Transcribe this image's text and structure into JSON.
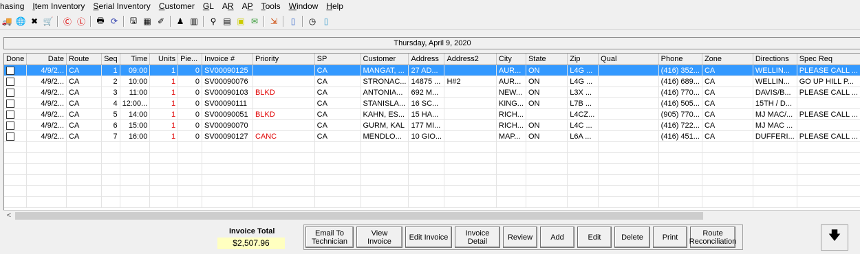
{
  "menu": [
    "hasing",
    "Item Inventory",
    "Serial Inventory",
    "Customer",
    "GL",
    "AR",
    "AP",
    "Tools",
    "Window",
    "Help"
  ],
  "menu_underline": [
    "",
    "I",
    "S",
    "C",
    "G",
    "R",
    "P",
    "T",
    "W",
    "H"
  ],
  "toolbar_icons": [
    "truck-icon",
    "globe-icon",
    "tools-icon",
    "cart-icon",
    "sep",
    "no-c-icon",
    "no-l-icon",
    "sep",
    "printer-icon",
    "refresh-icon",
    "sep",
    "disk-icon",
    "calculator-icon",
    "eraser-icon",
    "sep",
    "user-icon",
    "barcode-icon",
    "sep",
    "pin-icon",
    "notes-icon",
    "note-icon",
    "chat-icon",
    "sep",
    "exit-icon",
    "sep",
    "book-icon",
    "sep",
    "clock-icon",
    "page-icon"
  ],
  "date_header": "Thursday, April 9, 2020",
  "columns": [
    "Done",
    "Date",
    "Route",
    "Seq",
    "Time",
    "Units",
    "Pie...",
    "Invoice #",
    "Priority",
    "SP",
    "Customer",
    "Address",
    "Address2",
    "City",
    "State",
    "Zip",
    "Qual",
    "Phone",
    "Zone",
    "Directions",
    "Spec Req"
  ],
  "rows": [
    {
      "date": "4/9/2...",
      "route": "CA",
      "seq": "1",
      "time": "09:00",
      "units": "1",
      "pie": "0",
      "invoice": "SV00090125",
      "priority": "",
      "sp": "CA",
      "customer": "MANGAT, ...",
      "address": "27 AD...",
      "address2": "",
      "city": "AUR...",
      "state": "ON",
      "zip": "L4G ...",
      "qual": "",
      "phone": "(416) 352...",
      "zone": "CA",
      "directions": "WELLIN...",
      "specreq": "PLEASE CALL ..."
    },
    {
      "date": "4/9/2...",
      "route": "CA",
      "seq": "2",
      "time": "10:00",
      "units": "1",
      "pie": "0",
      "invoice": "SV00090076",
      "priority": "",
      "sp": "CA",
      "customer": "STRONAC...",
      "address": "14875 ...",
      "address2": "H#2",
      "city": "AUR...",
      "state": "ON",
      "zip": "L4G ...",
      "qual": "",
      "phone": "(416) 689...",
      "zone": "CA",
      "directions": "WELLIN...",
      "specreq": "GO UP HILL P..."
    },
    {
      "date": "4/9/2...",
      "route": "CA",
      "seq": "3",
      "time": "11:00",
      "units": "1",
      "pie": "0",
      "invoice": "SV00090103",
      "priority": "BLKD",
      "sp": "CA",
      "customer": "ANTONIA...",
      "address": "692 M...",
      "address2": "",
      "city": "NEW...",
      "state": "ON",
      "zip": "L3X ...",
      "qual": "",
      "phone": "(416) 770...",
      "zone": "CA",
      "directions": "DAVIS/B...",
      "specreq": "PLEASE CALL ..."
    },
    {
      "date": "4/9/2...",
      "route": "CA",
      "seq": "4",
      "time": "12:00...",
      "units": "1",
      "pie": "0",
      "invoice": "SV00090111",
      "priority": "",
      "sp": "CA",
      "customer": "STANISLA...",
      "address": "16 SC...",
      "address2": "",
      "city": "KING...",
      "state": "ON",
      "zip": "L7B ...",
      "qual": "",
      "phone": "(416) 505...",
      "zone": "CA",
      "directions": "15TH / D...",
      "specreq": ""
    },
    {
      "date": "4/9/2...",
      "route": "CA",
      "seq": "5",
      "time": "14:00",
      "units": "1",
      "pie": "0",
      "invoice": "SV00090051",
      "priority": "BLKD",
      "sp": "CA",
      "customer": "KAHN, ES...",
      "address": "15 HA...",
      "address2": "",
      "city": "RICH...",
      "state": "",
      "zip": "L4CZ...",
      "qual": "",
      "phone": "(905) 770...",
      "zone": "CA",
      "directions": "MJ MAC/...",
      "specreq": "PLEASE CALL ..."
    },
    {
      "date": "4/9/2...",
      "route": "CA",
      "seq": "6",
      "time": "15:00",
      "units": "1",
      "pie": "0",
      "invoice": "SV00090070",
      "priority": "",
      "sp": "CA",
      "customer": "GURM, KAL",
      "address": "177 MI...",
      "address2": "",
      "city": "RICH...",
      "state": "ON",
      "zip": "L4C ...",
      "qual": "",
      "phone": "(416) 722...",
      "zone": "CA",
      "directions": "MJ MAC ...",
      "specreq": ""
    },
    {
      "date": "4/9/2...",
      "route": "CA",
      "seq": "7",
      "time": "16:00",
      "units": "1",
      "pie": "0",
      "invoice": "SV00090127",
      "priority": "CANC",
      "sp": "CA",
      "customer": "MENDLO...",
      "address": "10 GIO...",
      "address2": "",
      "city": "MAP...",
      "state": "ON",
      "zip": "L6A ...",
      "qual": "",
      "phone": "(416) 451...",
      "zone": "CA",
      "directions": "DUFFERI...",
      "specreq": "PLEASE CALL ..."
    }
  ],
  "selected_row": 0,
  "invoice_total_label": "Invoice Total",
  "invoice_total_value": "$2,507.96",
  "buttons": [
    {
      "label": "Email To\nTechnician",
      "name": "email-technician-button"
    },
    {
      "label": "View Invoice",
      "name": "view-invoice-button"
    },
    {
      "label": "Edit Invoice",
      "name": "edit-invoice-button"
    },
    {
      "label": "Invoice\nDetail",
      "name": "invoice-detail-button"
    },
    {
      "label": "Review",
      "name": "review-button"
    },
    {
      "label": "Add",
      "name": "add-button"
    },
    {
      "label": "Edit",
      "name": "edit-button"
    },
    {
      "label": "Delete",
      "name": "delete-button"
    },
    {
      "label": "Print",
      "name": "print-button"
    },
    {
      "label": "Route\nReconciliation",
      "name": "route-reconciliation-button"
    }
  ],
  "arrow_button_glyph": "🡇",
  "scroll_left_glyph": "<"
}
